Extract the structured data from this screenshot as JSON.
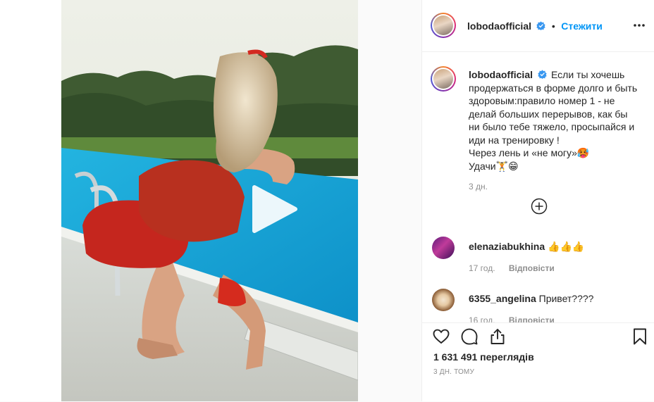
{
  "post": {
    "author": "lobodaofficial",
    "follow_label": "Стежити",
    "separator": "•",
    "caption_lines": [
      "Если ты хочешь",
      "продержаться в форме долго и быть",
      "здоровым:правило номер 1 - не",
      "делай больших перерывов, как бы",
      "ни было тебе тяжело, просыпайся и",
      "иди на тренировку !",
      "Через лень и «не могу»🥵",
      "Удачи🏋️😁"
    ],
    "caption_time": "3 дн."
  },
  "comments": [
    {
      "username": "elenaziabukhina",
      "text": "👍👍👍",
      "time": "17 год.",
      "reply_label": "Відповісти"
    },
    {
      "username": "6355_angelina",
      "text": "Привет????",
      "time": "16 год.",
      "reply_label": "Відповісти"
    }
  ],
  "footer": {
    "views": "1 631 491 переглядів",
    "date": "3 ДН. ТОМУ"
  },
  "icons": {
    "play": "play-icon",
    "more": "more-icon",
    "add": "add-comment-icon",
    "like": "heart-icon",
    "comment": "comment-icon",
    "share": "share-icon",
    "save": "bookmark-icon"
  },
  "colors": {
    "follow": "#0095f6",
    "verified": "#3897f0",
    "muted": "#8e8e8e",
    "text": "#262626"
  }
}
